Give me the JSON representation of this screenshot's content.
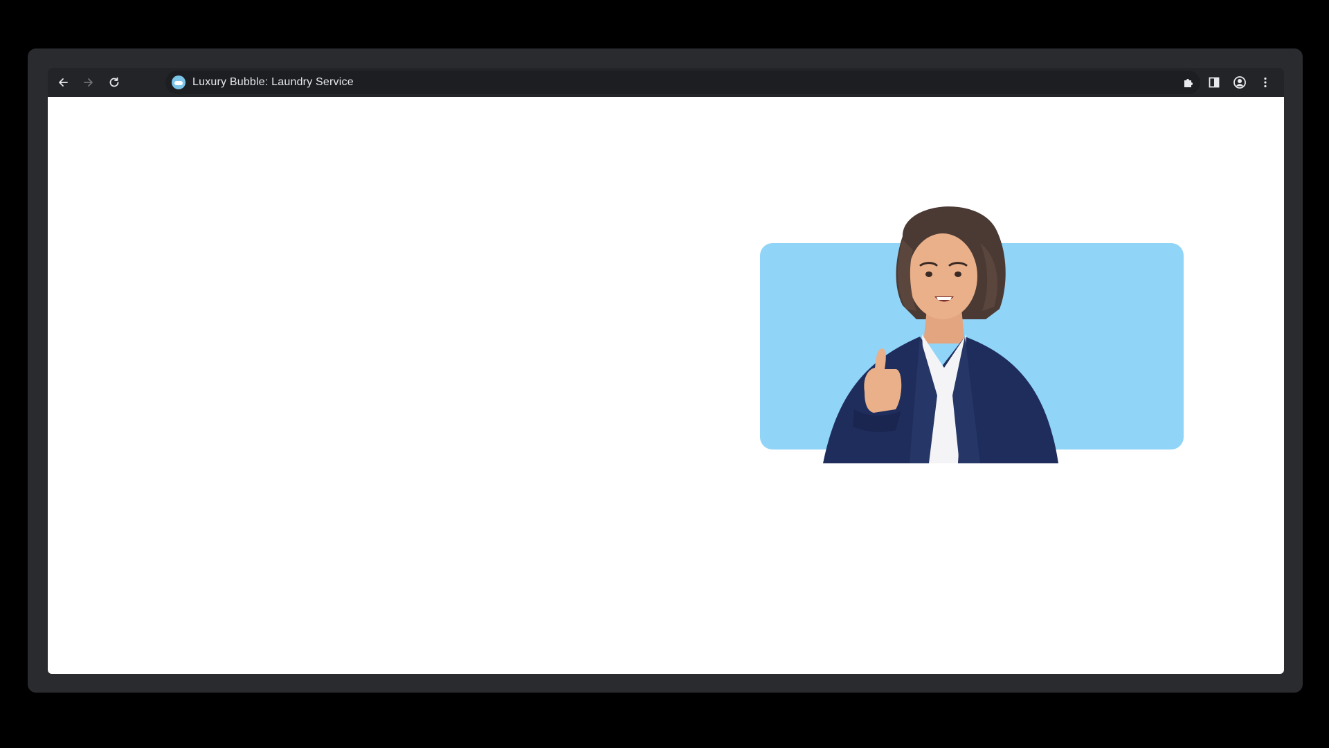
{
  "browser": {
    "tab_title": "Luxury Bubble: Laundry Service",
    "nav": {
      "back_icon": "arrow-left-icon",
      "forward_icon": "arrow-right-icon",
      "reload_icon": "reload-icon"
    },
    "toolbar_icons": [
      "puzzle-icon",
      "side-panel-icon",
      "profile-icon",
      "kebab-menu-icon"
    ]
  },
  "page": {
    "hero": {
      "card_color": "#90d4f8",
      "illustration": "woman-thumbs-up-avatar"
    }
  },
  "colors": {
    "frame": "#2a2b2e",
    "toolbar": "#232427",
    "omnibox": "#1d1e21",
    "accent_blue": "#90d4f8",
    "jacket_navy": "#1f2d5c"
  }
}
